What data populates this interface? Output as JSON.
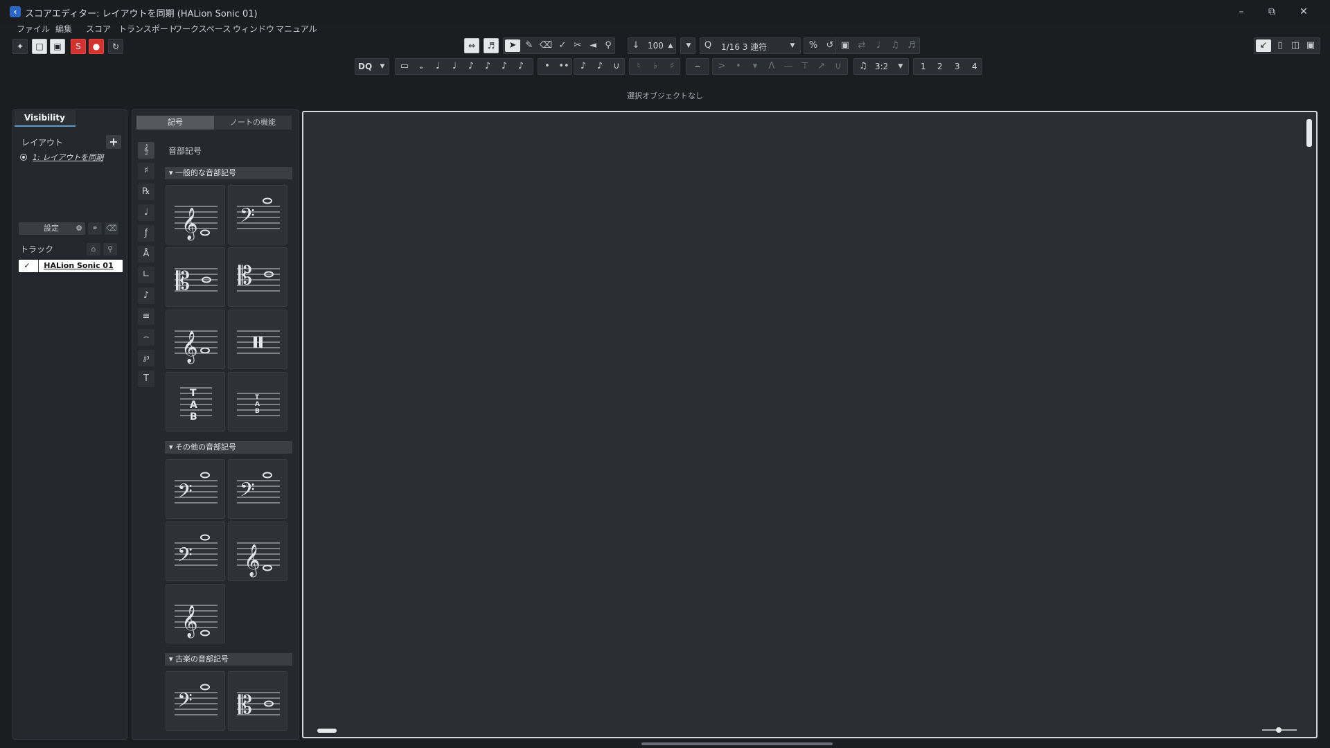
{
  "window": {
    "title": "スコアエディター: レイアウトを同期 (HALion Sonic 01)",
    "app_icon": "cubase-icon"
  },
  "menu": [
    "ファイル",
    "編集",
    "スコア",
    "トランスポート",
    "ワークスペース",
    "ウィンドウ",
    "マニュアル"
  ],
  "toolbar": {
    "velocity": "100",
    "quantize": "1/16 3 連符",
    "dq_label": "DQ",
    "tuplet": "3:2",
    "voices": [
      "1",
      "2",
      "3",
      "4"
    ]
  },
  "status": "選択オブジェクトなし",
  "inspector": {
    "tab": "Visibility",
    "layout_heading": "レイアウト",
    "layout_item": "1: レイアウトを同期",
    "settings_label": "設定",
    "track_heading": "トラック",
    "track_check": "✓",
    "track_name": "HALion Sonic 01"
  },
  "symbols": {
    "tabs": [
      "記号",
      "ノートの機能"
    ],
    "title": "音部記号",
    "sections": [
      "一般的な音部記号",
      "その他の音部記号",
      "古楽の音部記号"
    ]
  },
  "colors": {
    "record": "#d3322f",
    "accent": "#5b9ed6",
    "background": "#1b1d20"
  }
}
